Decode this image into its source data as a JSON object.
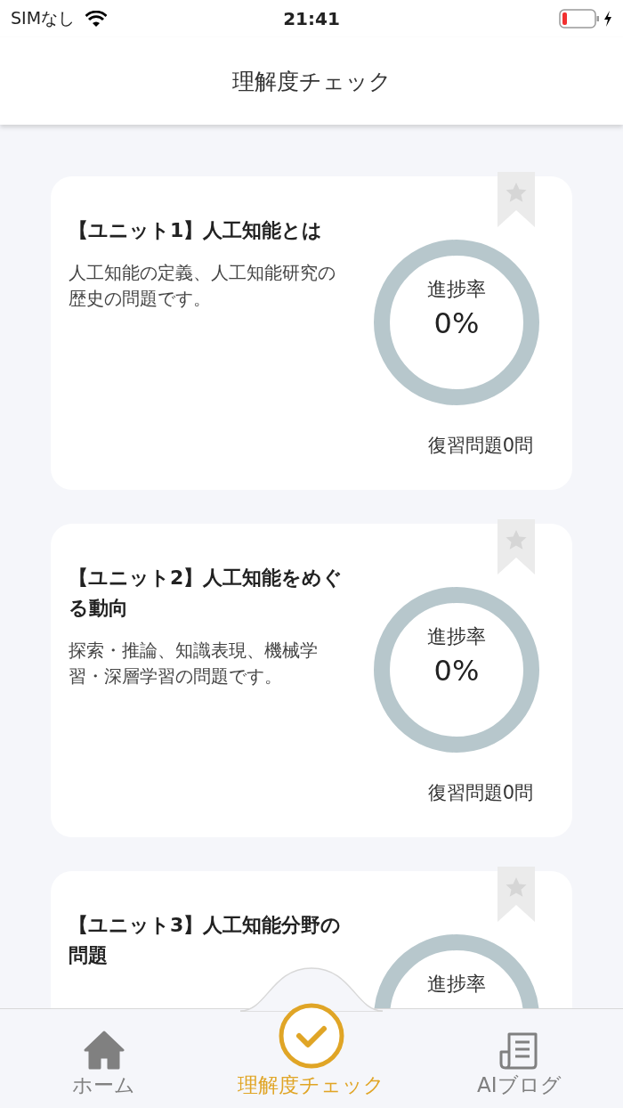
{
  "status_bar": {
    "carrier": "SIMなし",
    "time": "21:41",
    "charging": true
  },
  "header": {
    "title": "理解度チェック"
  },
  "cards": [
    {
      "title": "【ユニット1】人工知能とは",
      "description": "人工知能の定義、人工知能研究の歴史の問題です。",
      "progress_label": "進捗率",
      "percent": "0%",
      "level": 0,
      "review": "復習問題0問",
      "bookmarked": false
    },
    {
      "title": "【ユニット2】人工知能をめぐる動向",
      "description": "探索・推論、知識表現、機械学習・深層学習の問題です。",
      "progress_label": "進捗率",
      "percent": "0%",
      "level": 0,
      "review": "復習問題0問",
      "bookmarked": false
    },
    {
      "title": "【ユニット3】人工知能分野の問題",
      "progress_label": "進捗率",
      "level": 0,
      "bookmarked": false
    }
  ],
  "tabs": [
    {
      "kind": "home",
      "label": "ホーム",
      "selected": false
    },
    {
      "kind": "check",
      "label": "理解度チェック",
      "selected": true
    },
    {
      "kind": "blog",
      "label": "AIブログ",
      "selected": false
    }
  ]
}
